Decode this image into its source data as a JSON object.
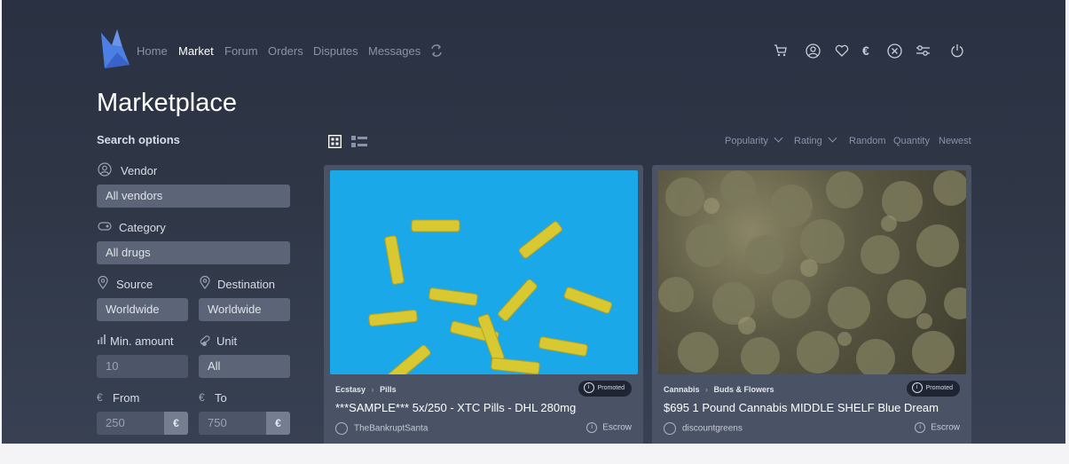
{
  "nav": {
    "items": [
      "Home",
      "Market",
      "Forum",
      "Orders",
      "Disputes",
      "Messages"
    ],
    "active": "Market",
    "icons": [
      "refresh-icon",
      "cart-icon",
      "user-icon",
      "heart-icon",
      "euro-icon",
      "bitcoin-icon",
      "settings-icon",
      "power-icon"
    ],
    "currency_symbol": "€"
  },
  "page": {
    "title": "Marketplace"
  },
  "search": {
    "heading": "Search options",
    "vendor": {
      "label": "Vendor",
      "value": "All vendors"
    },
    "category": {
      "label": "Category",
      "value": "All drugs"
    },
    "source": {
      "label": "Source",
      "value": "Worldwide"
    },
    "destination": {
      "label": "Destination",
      "value": "Worldwide"
    },
    "min_amount": {
      "label": "Min. amount",
      "placeholder": "10"
    },
    "unit": {
      "label": "Unit",
      "value": "All"
    },
    "from": {
      "label": "From",
      "placeholder": "250",
      "currency": "€"
    },
    "to": {
      "label": "To",
      "placeholder": "750",
      "currency": "€"
    }
  },
  "sort": {
    "options": [
      "Popularity",
      "Rating",
      "Random",
      "Quantity",
      "Newest"
    ]
  },
  "listings": [
    {
      "category": "Ecstasy",
      "subcategory": "Pills",
      "badge": "Promoted",
      "title": "***SAMPLE*** 5x/250 - XTC Pills - DHL 280mg",
      "vendor": "TheBankruptSanta",
      "payment": "Escrow",
      "image_color": "#1aa8e8"
    },
    {
      "category": "Cannabis",
      "subcategory": "Buds & Flowers",
      "badge": "Promoted",
      "title": "$695 1 Pound Cannabis MIDDLE SHELF Blue Dream",
      "vendor": "discountgreens",
      "payment": "Escrow",
      "image_color": "#6e6a52"
    }
  ],
  "colors": {
    "accent_logo": "#4f7de0",
    "promo_bg": "#1f2533"
  }
}
